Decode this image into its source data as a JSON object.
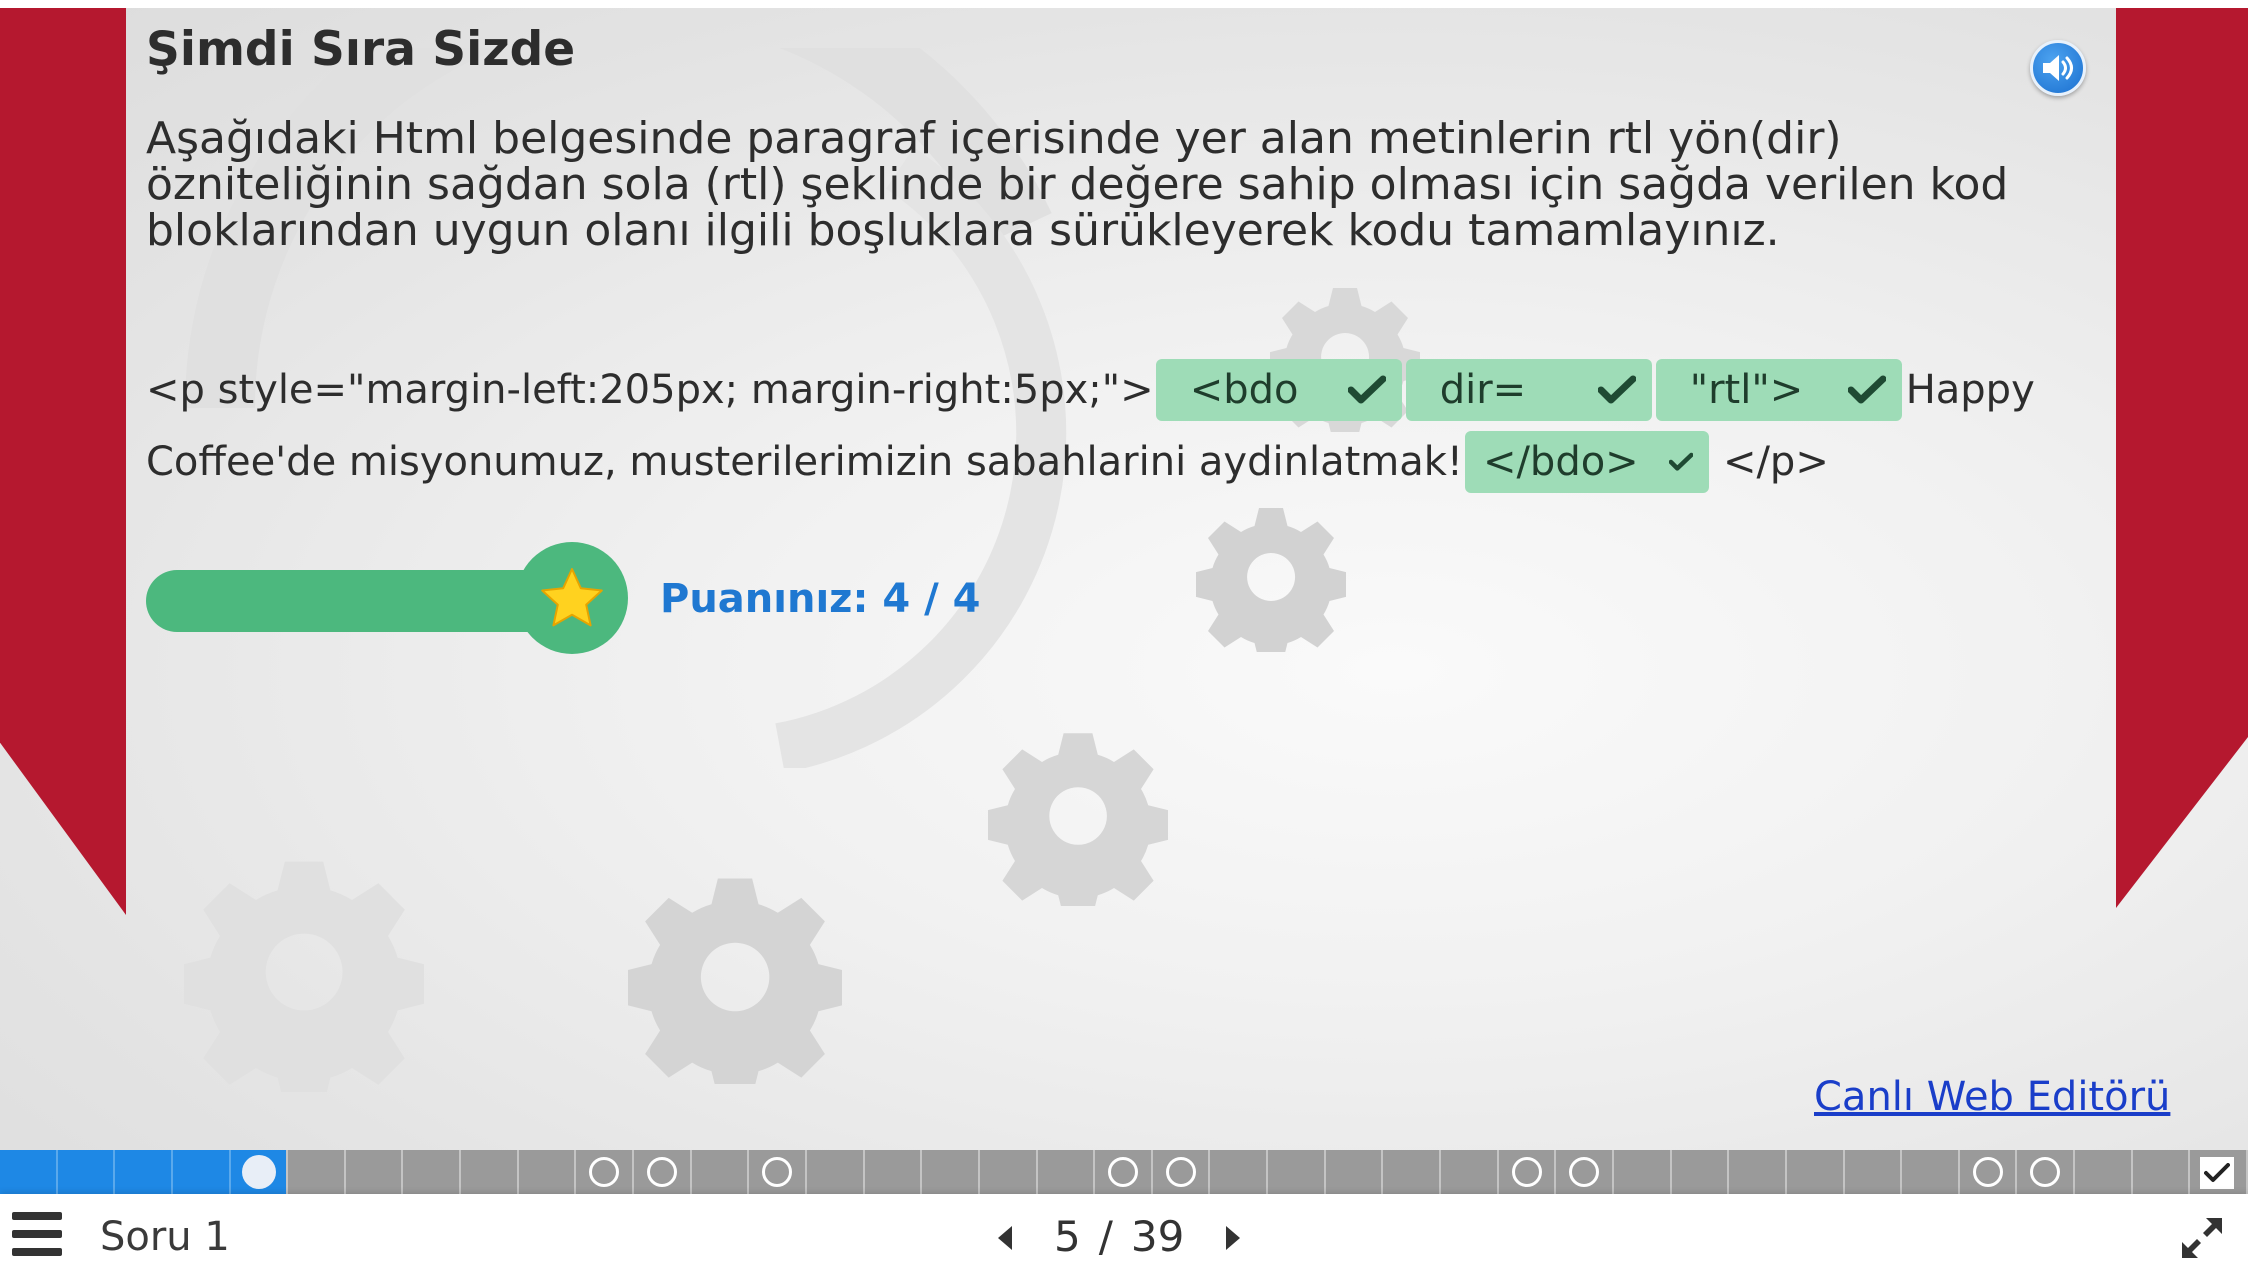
{
  "header": {
    "title": "Şimdi Sıra Sizde",
    "instructions": "Aşağıdaki Html belgesinde paragraf içerisinde yer alan metinlerin rtl yön(dir) özniteliğinin sağdan sola (rtl) şeklinde bir değere sahip olması için sağda verilen kod bloklarından uygun olanı ilgili boşluklara sürükleyerek kodu tamamlayınız."
  },
  "exercise": {
    "line1_prefix": "<p style=\"margin-left:205px; margin-right:5px;\">",
    "drop1": "<bdo",
    "drop2": "dir=",
    "drop3": "\"rtl\">",
    "line1_suffix": "Happy",
    "line2_prefix": "Coffee'de misyonumuz, musterilerimizin sabahlarini aydinlatmak!",
    "drop4": "</bdo>",
    "line2_suffix": "</p>",
    "answer_state": "correct",
    "answer_color": "#9edcb7"
  },
  "score": {
    "label": "Puanınız: 4 / 4",
    "earned": 4,
    "total": 4,
    "fill_fraction": 1.0,
    "bar_color": "#4cb87e",
    "text_color": "#1f78d1"
  },
  "links": {
    "live_editor": "Canlı Web Editörü"
  },
  "progress": {
    "total_pages": 39,
    "current_page": 5,
    "cells": [
      "done",
      "done",
      "done",
      "done",
      "current",
      "plain",
      "plain",
      "plain",
      "plain",
      "plain",
      "ring",
      "ring",
      "plain",
      "ring",
      "plain",
      "plain",
      "plain",
      "plain",
      "plain",
      "ring",
      "ring",
      "plain",
      "plain",
      "plain",
      "plain",
      "plain",
      "ring",
      "ring",
      "plain",
      "plain",
      "plain",
      "plain",
      "plain",
      "plain",
      "ring",
      "ring",
      "plain",
      "plain",
      "finish"
    ],
    "accent_color": "#1e88e5"
  },
  "footer": {
    "section_label": "Soru 1",
    "current": "5",
    "separator": "/",
    "total": "39"
  },
  "icons": {
    "audio": "speaker-icon",
    "menu": "hamburger-menu-icon",
    "prev": "caret-left-icon",
    "next": "caret-right-icon",
    "fullscreen": "expand-arrows-icon",
    "check": "checkmark-icon",
    "star": "star-icon"
  }
}
